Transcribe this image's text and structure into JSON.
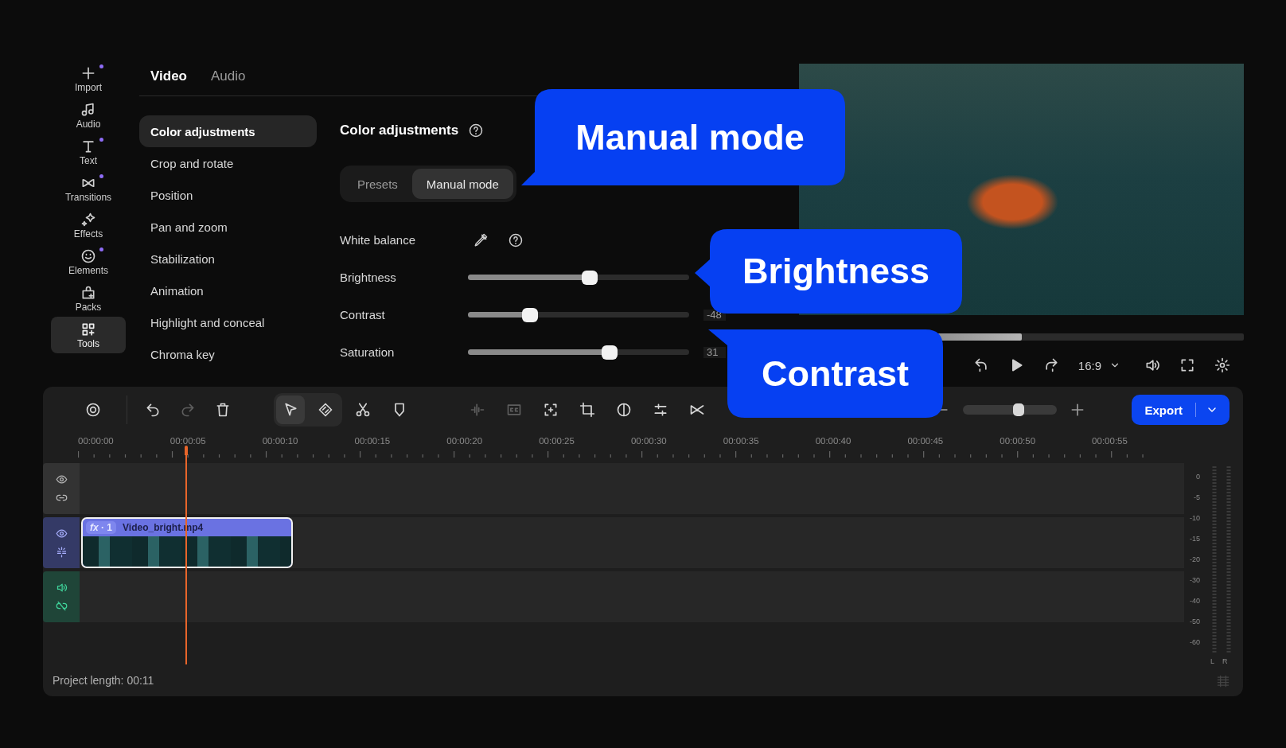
{
  "sidebar": {
    "items": [
      {
        "label": "Import",
        "badge": true,
        "selected": false
      },
      {
        "label": "Audio",
        "badge": false,
        "selected": false
      },
      {
        "label": "Text",
        "badge": true,
        "selected": false
      },
      {
        "label": "Transitions",
        "badge": true,
        "selected": false
      },
      {
        "label": "Effects",
        "badge": false,
        "selected": false
      },
      {
        "label": "Elements",
        "badge": true,
        "selected": false
      },
      {
        "label": "Packs",
        "badge": false,
        "selected": false
      },
      {
        "label": "Tools",
        "badge": false,
        "selected": true
      }
    ]
  },
  "tabs": [
    {
      "label": "Video",
      "selected": true
    },
    {
      "label": "Audio",
      "selected": false
    }
  ],
  "menu": [
    {
      "label": "Color adjustments",
      "selected": true
    },
    {
      "label": "Crop and rotate",
      "selected": false
    },
    {
      "label": "Position",
      "selected": false
    },
    {
      "label": "Pan and zoom",
      "selected": false
    },
    {
      "label": "Stabilization",
      "selected": false
    },
    {
      "label": "Animation",
      "selected": false
    },
    {
      "label": "Highlight and conceal",
      "selected": false
    },
    {
      "label": "Chroma key",
      "selected": false
    }
  ],
  "panel": {
    "title": "Color adjustments",
    "modes": [
      {
        "label": "Presets",
        "selected": false
      },
      {
        "label": "Manual mode",
        "selected": true
      }
    ],
    "white_balance": {
      "label": "White balance"
    },
    "sliders": [
      {
        "label": "Brightness",
        "level": 0.55
      },
      {
        "label": "Contrast",
        "level": 0.28,
        "value": "-48"
      },
      {
        "label": "Saturation",
        "level": 0.64,
        "value": "31"
      }
    ]
  },
  "preview": {
    "progress": {
      "level": 0.5
    },
    "aspect": "16:9"
  },
  "toolbar": {
    "tools": [
      {
        "disabled": false,
        "selected": false
      },
      {
        "disabled": false,
        "selected": false
      },
      {
        "disabled": true,
        "selected": false
      },
      {
        "disabled": false,
        "selected": false
      },
      {
        "disabled": false,
        "selected": true
      },
      {
        "disabled": false,
        "selected": false
      },
      {
        "disabled": false,
        "selected": false
      },
      {
        "disabled": false,
        "selected": false
      },
      {
        "disabled": true,
        "selected": false
      },
      {
        "disabled": true,
        "selected": false
      },
      {
        "disabled": false,
        "selected": false
      },
      {
        "disabled": false,
        "selected": false
      },
      {
        "disabled": false,
        "selected": false
      },
      {
        "disabled": false,
        "selected": false
      },
      {
        "disabled": false,
        "selected": false
      }
    ],
    "zoom": {
      "level": 0.59
    },
    "export": "Export"
  },
  "ruler": [
    "00:00:00",
    "00:00:05",
    "00:00:10",
    "00:00:15",
    "00:00:20",
    "00:00:25",
    "00:00:30",
    "00:00:35",
    "00:00:40",
    "00:00:45",
    "00:00:50",
    "00:00:55"
  ],
  "tracks": [
    {
      "kind": "overlay",
      "color": "#333333"
    },
    {
      "kind": "video",
      "color": "#343a66",
      "clip": {
        "badge": "*fx* · 1",
        "name": "Video_bright.mp4"
      }
    },
    {
      "kind": "audio",
      "color": "#1f4538"
    }
  ],
  "status": "Project length: 00:11",
  "meter": {
    "scale": [
      "0",
      "-5",
      "-10",
      "-15",
      "-20",
      "-30",
      "-40",
      "-50",
      "-60"
    ],
    "channels": [
      "L",
      "R"
    ]
  },
  "callouts": [
    {
      "text": "Manual mode"
    },
    {
      "text": "Brightness"
    },
    {
      "text": "Contrast"
    }
  ]
}
